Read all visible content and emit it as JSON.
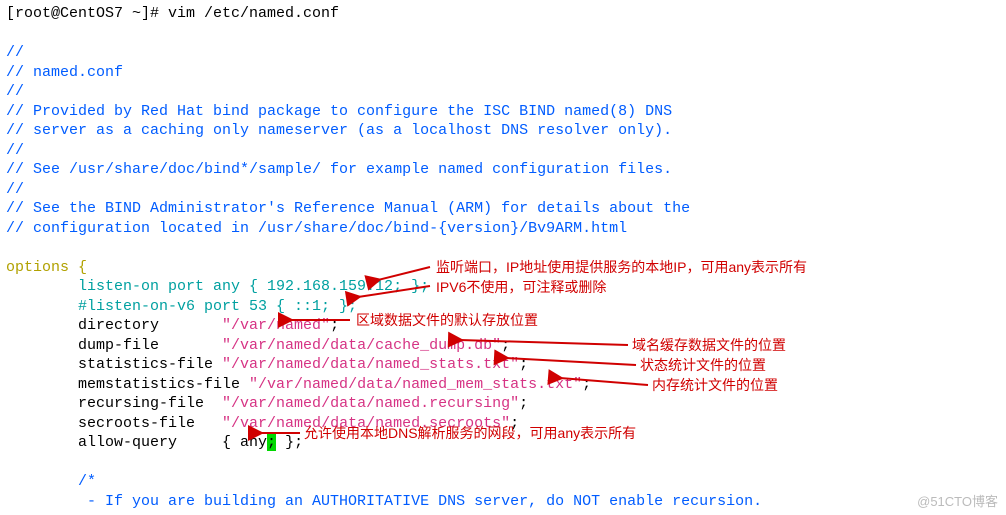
{
  "prompt": "[root@CentOS7 ~]# vim /etc/named.conf",
  "comments": {
    "c1": "//",
    "c2": "// named.conf",
    "c3": "//",
    "c4": "// Provided by Red Hat bind package to configure the ISC BIND named(8) DNS",
    "c5": "// server as a caching only nameserver (as a localhost DNS resolver only).",
    "c6": "//",
    "c7": "// See /usr/share/doc/bind*/sample/ for example named configuration files.",
    "c8": "//",
    "c9": "// See the BIND Administrator's Reference Manual (ARM) for details about the",
    "c10": "// configuration located in /usr/share/doc/bind-{version}/Bv9ARM.html"
  },
  "options": {
    "open": "options {",
    "listen_on_a": "        listen-on port any { 192.168.159.12; };",
    "listen_on_b": "        #listen-on-v6 port 53 { ::1; };",
    "dir_key": "        directory       ",
    "dir_val": "\"/var/named\"",
    "dump_key": "        dump-file       ",
    "dump_val": "\"/var/named/data/cache_dump.db\"",
    "stat_key": "        statistics-file ",
    "stat_val": "\"/var/named/data/named_stats.txt\"",
    "mem_key": "        memstatistics-file ",
    "mem_val": "\"/var/named/data/named_mem_stats.txt\"",
    "recur_key": "        recursing-file  ",
    "recur_val": "\"/var/named/data/named.recursing\"",
    "secr_key": "        secroots-file   ",
    "secr_val": "\"/var/named/data/named.secroots\"",
    "allow_a": "        allow-query     { any",
    "allow_cursor": ";",
    "allow_b": " };"
  },
  "tail": {
    "t1": "        /*",
    "t2": "         - If you are building an AUTHORITATIVE DNS server, do NOT enable recursion."
  },
  "anno": {
    "listen": "监听端口，IP地址使用提供服务的本地IP，可用any表示所有",
    "ipv6": "IPV6不使用，可注释或删除",
    "dir": "区域数据文件的默认存放位置",
    "dump": "域名缓存数据文件的位置",
    "stat": "状态统计文件的位置",
    "mem": "内存统计文件的位置",
    "allow": "允许使用本地DNS解析服务的网段，可用any表示所有"
  },
  "watermark": "@51CTO博客"
}
